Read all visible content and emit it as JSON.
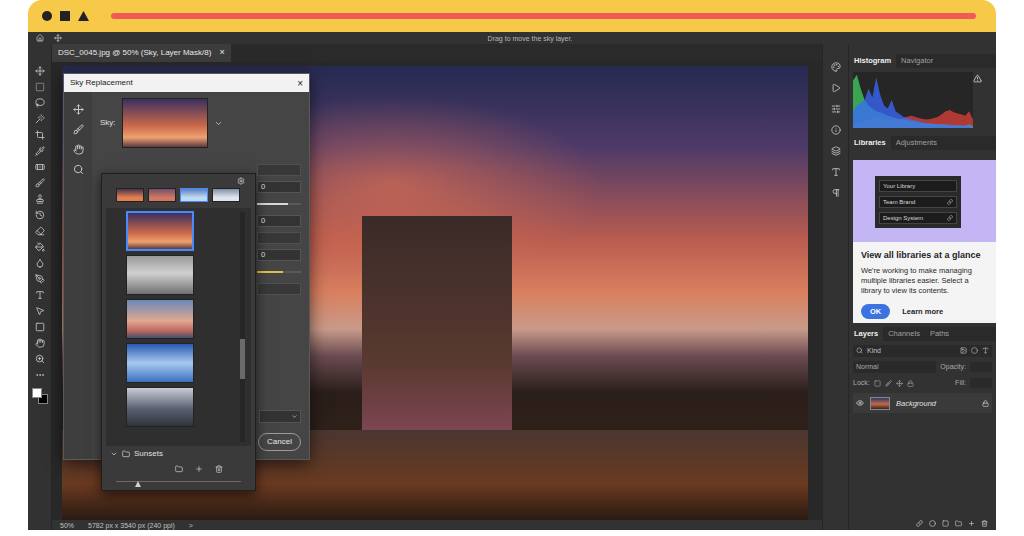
{
  "options_bar": {
    "hint": "Drag to move the sky layer."
  },
  "document_tab": {
    "title": "DSC_0045.jpg @ 50% (Sky, Layer Mask/8)",
    "close": "×"
  },
  "status_bar": {
    "zoom": "50%",
    "size": "5782 px x 3540 px (240 ppi)",
    "arrow": ">"
  },
  "sky_dialog": {
    "title": "Sky Replacement",
    "close": "×",
    "sky_label": "Sky:",
    "controls": [
      {
        "kind": "box"
      },
      {
        "kind": "field",
        "value": "0"
      },
      {
        "kind": "slider",
        "level": 0.7,
        "color": "#d9d9d9"
      },
      {
        "kind": "field",
        "value": "0"
      },
      {
        "kind": "box"
      },
      {
        "kind": "field",
        "value": "0"
      },
      {
        "kind": "slider",
        "level": 0.6,
        "color": "#e0c040"
      },
      {
        "kind": "box"
      }
    ],
    "cancel": "Cancel"
  },
  "sky_picker": {
    "top_thumbs": [
      {
        "selected": false
      },
      {
        "selected": false
      },
      {
        "selected": true
      },
      {
        "selected": false
      }
    ],
    "presets": [
      {
        "selected": true
      },
      {
        "selected": false
      },
      {
        "selected": false
      },
      {
        "selected": false
      },
      {
        "selected": false
      }
    ],
    "folder": "Sunsets",
    "scroll_level": 0.55,
    "size_level": 0.15
  },
  "histogram_panel": {
    "tabs": [
      {
        "label": "Histogram",
        "selected": true
      },
      {
        "label": "Navigator",
        "selected": false
      }
    ],
    "series": [
      {
        "name": "red",
        "color": "#e0403a",
        "values": [
          5,
          8,
          10,
          12,
          15,
          18,
          20,
          18,
          16,
          15,
          14,
          15,
          16,
          18,
          20,
          22,
          20,
          18,
          16,
          15,
          16,
          18,
          20,
          25,
          30,
          32,
          28,
          26,
          24,
          22,
          30,
          15
        ]
      },
      {
        "name": "green",
        "color": "#40d060",
        "values": [
          85,
          95,
          70,
          50,
          40,
          35,
          30,
          28,
          25,
          22,
          20,
          18,
          16,
          15,
          14,
          13,
          12,
          10,
          9,
          8,
          8,
          7,
          7,
          6,
          6,
          5,
          5,
          5,
          4,
          4,
          6,
          3
        ]
      },
      {
        "name": "blue",
        "color": "#3a6aff",
        "values": [
          30,
          40,
          45,
          50,
          70,
          55,
          90,
          60,
          40,
          35,
          50,
          30,
          25,
          20,
          18,
          15,
          14,
          12,
          10,
          9,
          8,
          7,
          7,
          6,
          6,
          6,
          5,
          5,
          5,
          4,
          5,
          2
        ]
      }
    ]
  },
  "libraries_panel": {
    "tabs": [
      {
        "label": "Libraries",
        "selected": true
      },
      {
        "label": "Adjustments",
        "selected": false
      }
    ],
    "library_items": [
      "Your Library",
      "Team Brand",
      "Design System"
    ],
    "heading": "View all libraries at a glance",
    "body": "We're working to make managing multiple libraries easier. Select a library to view its contents.",
    "ok": "OK",
    "learn_more": "Learn more"
  },
  "layers_panel": {
    "tabs": [
      {
        "label": "Layers",
        "selected": true
      },
      {
        "label": "Channels",
        "selected": false
      },
      {
        "label": "Paths",
        "selected": false
      }
    ],
    "search": "Kind",
    "blend": "Normal",
    "opacity_label": "Opacity:",
    "lock_label": "Lock:",
    "fill_label": "Fill:",
    "layers": [
      {
        "name": "Background",
        "visible": true,
        "locked": true,
        "selected": false
      }
    ]
  }
}
